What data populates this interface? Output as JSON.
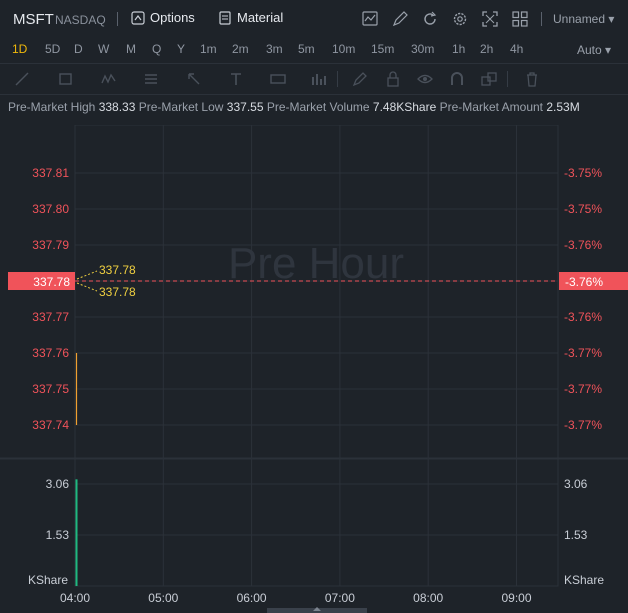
{
  "header": {
    "symbol": "MSFT",
    "exchange": "NASDAQ",
    "options_label": "Options",
    "material_label": "Material",
    "layout_name": "Unnamed"
  },
  "periods": [
    "1D",
    "5D",
    "D",
    "W",
    "M",
    "Q",
    "Y",
    "1m",
    "2m",
    "3m",
    "5m",
    "10m",
    "15m",
    "30m",
    "1h",
    "2h",
    "4h"
  ],
  "active_period": "1D",
  "scale_mode": "Auto",
  "info": {
    "high_label": "Pre-Market High",
    "high_value": "338.33",
    "low_label": "Pre-Market Low",
    "low_value": "337.55",
    "volume_label": "Pre-Market Volume",
    "volume_value": "7.48KShare",
    "amount_label": "Pre-Market Amount",
    "amount_value": "2.53M"
  },
  "chart_data": {
    "type": "line",
    "watermark": "Pre Hour",
    "price_axis_left": [
      "337.81",
      "337.80",
      "337.79",
      "337.78",
      "337.77",
      "337.76",
      "337.75",
      "337.74"
    ],
    "price_axis_right": [
      "-3.75%",
      "-3.75%",
      "-3.76%",
      "-3.76%",
      "-3.76%",
      "-3.77%",
      "-3.77%",
      "-3.77%"
    ],
    "price_levels": [
      337.81,
      337.8,
      337.79,
      337.78,
      337.77,
      337.76,
      337.75,
      337.74
    ],
    "current_price": "337.78",
    "current_change": "-3.76%",
    "high_marker": "337.78",
    "low_marker": "337.78",
    "volume_axis": [
      "3.06",
      "1.53"
    ],
    "volume_unit": "KShare",
    "time_axis": [
      "04:00",
      "05:00",
      "06:00",
      "07:00",
      "08:00",
      "09:00"
    ],
    "series": [
      {
        "x": [
          "04:00",
          "04:00"
        ],
        "y": [
          337.74,
          337.76
        ]
      }
    ],
    "volume": [
      {
        "x": "04:00",
        "value": 3.2
      }
    ]
  },
  "colors": {
    "accent": "#f0b90b",
    "down": "#f0535a",
    "line": "#f0a030",
    "volume_up": "#1fb980"
  }
}
